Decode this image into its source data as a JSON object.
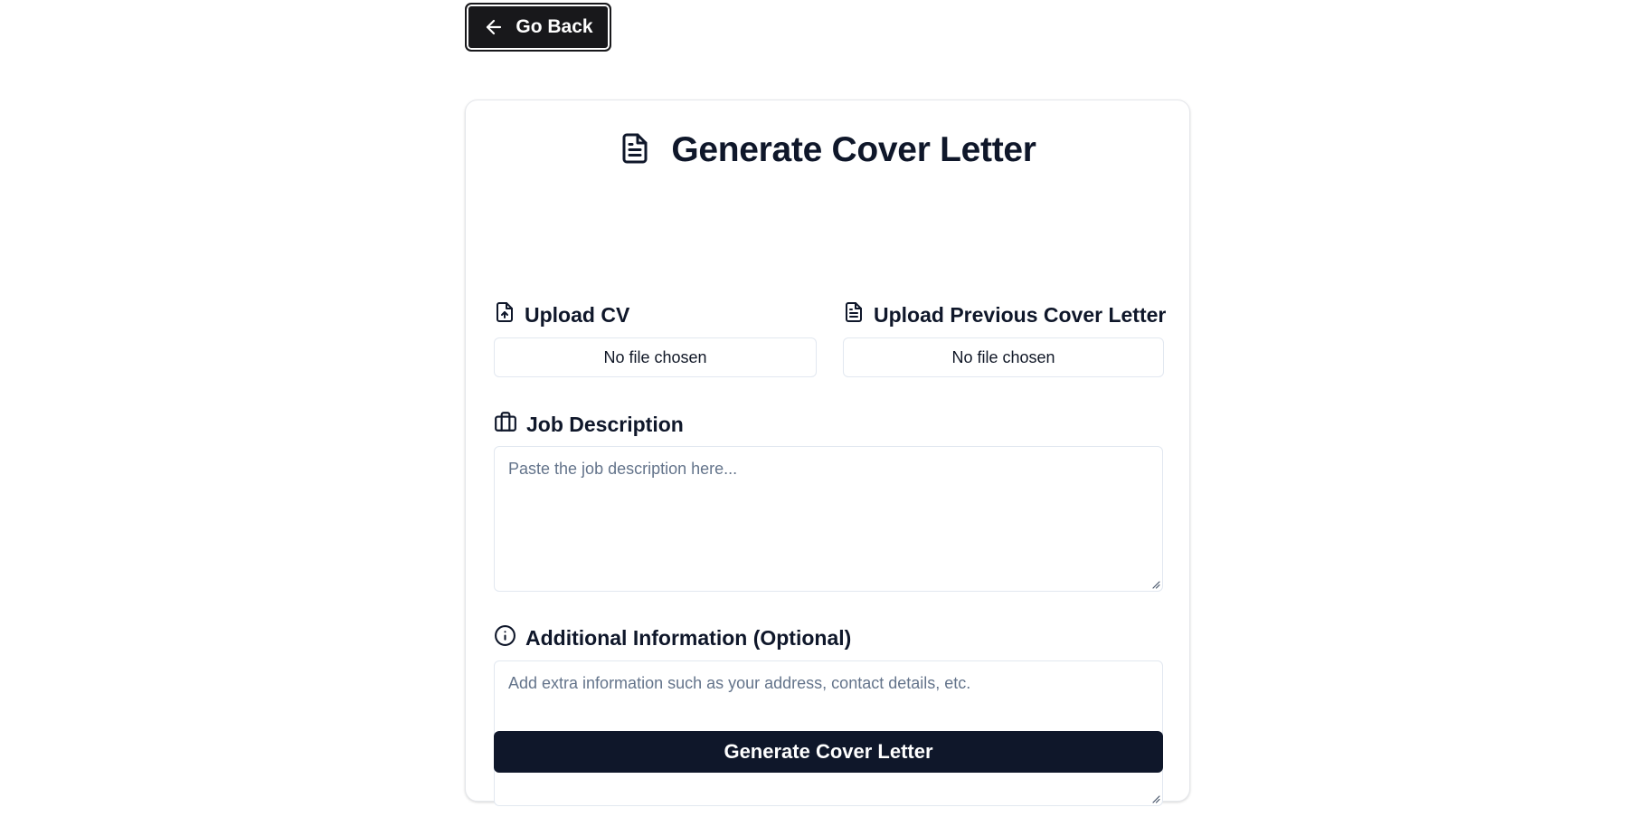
{
  "nav": {
    "back_label": "Go Back"
  },
  "form": {
    "title": "Generate Cover Letter",
    "upload_cv": {
      "label": "Upload CV",
      "status": "No file chosen"
    },
    "upload_previous": {
      "label": "Upload Previous Cover Letter",
      "status": "No file chosen"
    },
    "job_description": {
      "label": "Job Description",
      "placeholder": "Paste the job description here...",
      "value": ""
    },
    "additional_info": {
      "label": "Additional Information (Optional)",
      "placeholder": "Add extra information such as your address, contact details, etc.",
      "value": ""
    },
    "submit_label": "Generate Cover Letter"
  },
  "icons": {
    "back": "arrow-left-icon",
    "title": "file-text-icon",
    "upload_cv": "file-upload-icon",
    "upload_previous": "file-text-icon",
    "job_description": "briefcase-icon",
    "additional_info": "info-icon"
  },
  "colors": {
    "primary": "#0f172a",
    "back_button": "#18181b",
    "border": "#e2e8f0",
    "placeholder": "#64748b"
  }
}
